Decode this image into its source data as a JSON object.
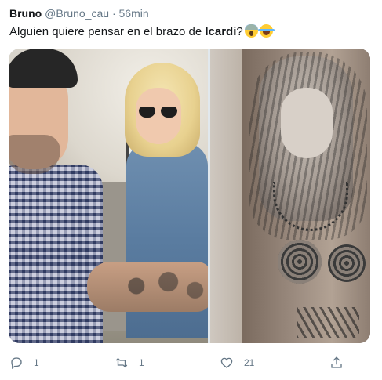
{
  "tweet": {
    "author_name": "Bruno",
    "handle": "@Bruno_cau",
    "separator": "·",
    "time": "56min",
    "text_before": "Alguien quiere pensar en el brazo de ",
    "text_bold": "Icardi",
    "text_after": "?",
    "emojis": [
      "face-screaming-in-fear-emoji",
      "face-with-tears-of-joy-emoji"
    ]
  },
  "actions": {
    "reply_count": "1",
    "retweet_count": "1",
    "like_count": "21"
  },
  "icons": {
    "reply": "reply-icon",
    "retweet": "retweet-icon",
    "like": "heart-icon",
    "share": "share-icon"
  },
  "colors": {
    "text_primary": "#14171a",
    "text_secondary": "#657786",
    "background": "#ffffff"
  }
}
